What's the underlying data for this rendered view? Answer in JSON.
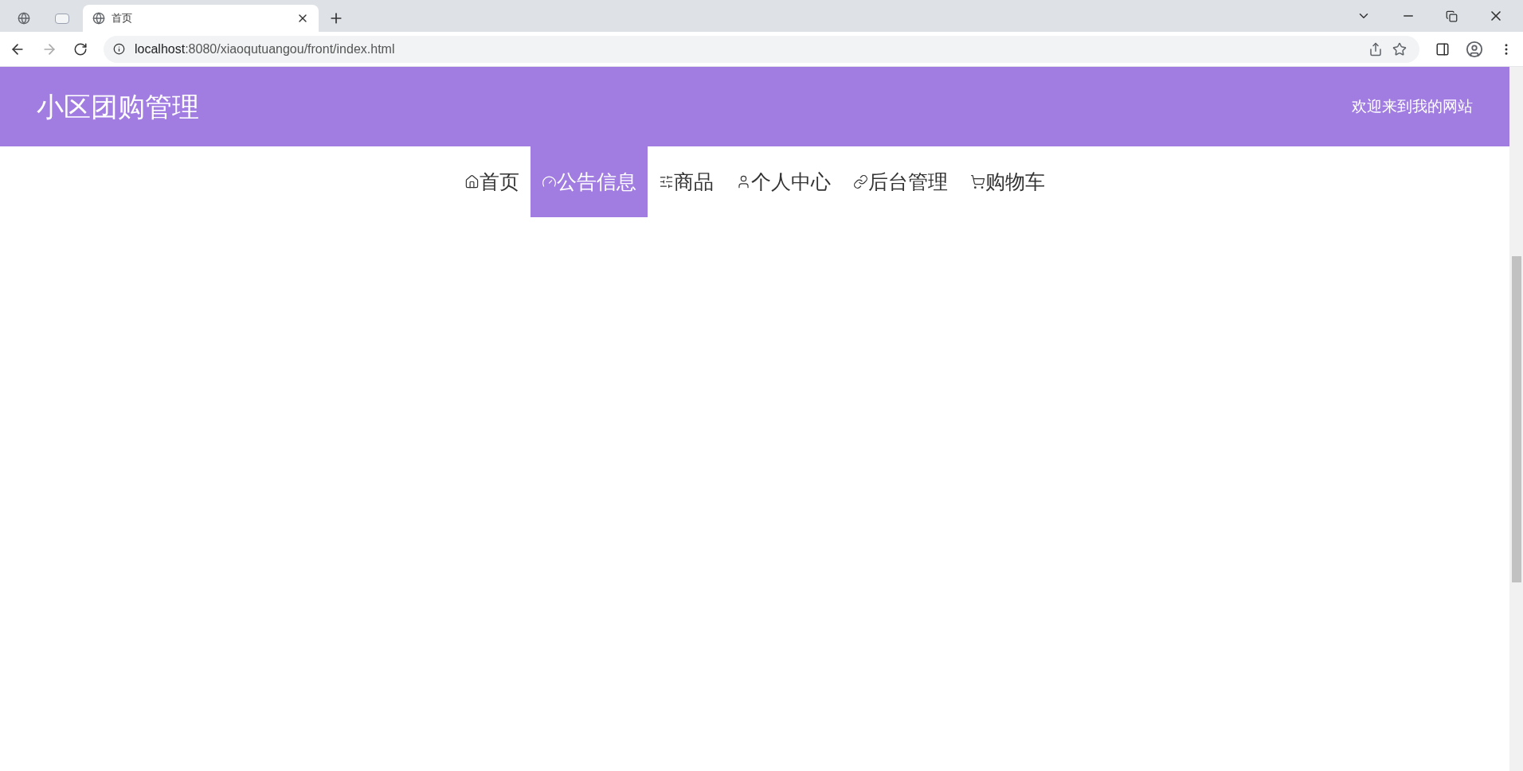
{
  "browser": {
    "tabs": [
      {
        "kind": "icon",
        "selected": false
      },
      {
        "kind": "blank",
        "selected": false
      },
      {
        "kind": "page",
        "title": "首页",
        "selected": true
      }
    ],
    "url": {
      "host": "localhost",
      "path": ":8080/xiaoqutuangou/front/index.html"
    }
  },
  "header": {
    "title": "小区团购管理",
    "welcome": "欢迎来到我的网站"
  },
  "nav": [
    {
      "label": "首页",
      "selected": false
    },
    {
      "label": "公告信息",
      "selected": true
    },
    {
      "label": "商品",
      "selected": false
    },
    {
      "label": "个人中心",
      "selected": false
    },
    {
      "label": "后台管理",
      "selected": false
    },
    {
      "label": "购物车",
      "selected": false
    }
  ]
}
